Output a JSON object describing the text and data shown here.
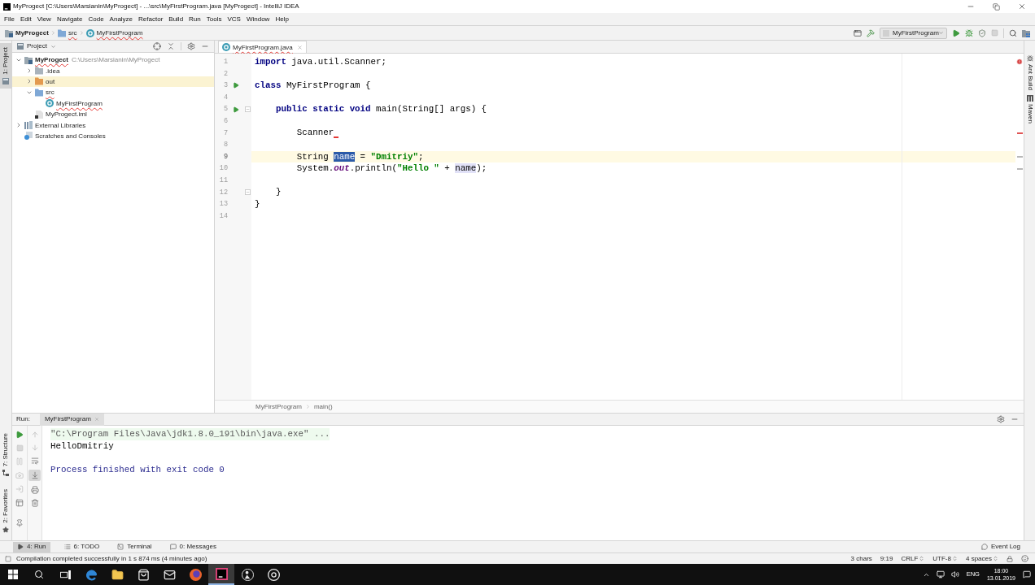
{
  "window": {
    "title": "MyProgect [C:\\Users\\Marsianin\\MyProgect] - ...\\src\\MyFirstProgram.java [MyProgect] - IntelliJ IDEA"
  },
  "menu": [
    "File",
    "Edit",
    "View",
    "Navigate",
    "Code",
    "Analyze",
    "Refactor",
    "Build",
    "Run",
    "Tools",
    "VCS",
    "Window",
    "Help"
  ],
  "navbar": {
    "breadcrumbs": [
      {
        "label": "MyProgect",
        "kind": "project",
        "error": false
      },
      {
        "label": "src",
        "kind": "source_folder",
        "error": true
      },
      {
        "label": "MyFirstProgram",
        "kind": "class",
        "error": true
      }
    ],
    "run_config": "MyFirstProgram"
  },
  "left_stripe": {
    "top": [
      {
        "label": "1: Project",
        "kind": "project",
        "selected": true
      }
    ],
    "bottom": [
      {
        "label": "7: Structure",
        "kind": "structure",
        "selected": false
      },
      {
        "label": "2: Favorites",
        "kind": "favorites",
        "selected": false
      }
    ]
  },
  "project_panel": {
    "title": "Project",
    "tree": [
      {
        "label": "MyProgect",
        "path": "C:\\Users\\Marsianin\\MyProgect",
        "kind": "project",
        "error": true,
        "selected": false,
        "expanded": true,
        "children": [
          {
            "label": ".idea",
            "kind": "folder",
            "error": false,
            "selected": false,
            "expanded": false
          },
          {
            "label": "out",
            "kind": "excluded_folder",
            "error": false,
            "selected": true,
            "expanded": false
          },
          {
            "label": "src",
            "kind": "source_folder",
            "error": true,
            "selected": false,
            "expanded": true,
            "children": [
              {
                "label": "MyFirstProgram",
                "kind": "class",
                "error": true,
                "selected": false
              }
            ]
          },
          {
            "label": "MyProgect.iml",
            "kind": "module_file",
            "error": false,
            "selected": false
          }
        ]
      },
      {
        "label": "External Libraries",
        "kind": "library",
        "error": false,
        "selected": false,
        "expanded": false
      },
      {
        "label": "Scratches and Consoles",
        "kind": "scratches",
        "error": false,
        "selected": false
      }
    ]
  },
  "editor": {
    "tabs": [
      {
        "label": "MyFirstProgram.java",
        "selected": true,
        "error": true
      }
    ],
    "lines": [
      {
        "number": "1",
        "current": false,
        "run": false,
        "fold": false,
        "error": false,
        "tokens": [
          {
            "text": "import",
            "kind": "keyword"
          },
          {
            "text": " java.util.Scanner;",
            "kind": "plain"
          }
        ]
      },
      {
        "number": "2",
        "current": false,
        "run": false,
        "fold": false,
        "error": false
      },
      {
        "number": "3",
        "current": false,
        "run": true,
        "fold": false,
        "error": false,
        "tokens": [
          {
            "text": "class",
            "kind": "keyword"
          },
          {
            "text": " MyFirstProgram {",
            "kind": "plain"
          }
        ]
      },
      {
        "number": "4",
        "current": false,
        "run": false,
        "fold": false,
        "error": false
      },
      {
        "number": "5",
        "current": false,
        "run": true,
        "fold": true,
        "error": false,
        "tokens": [
          {
            "text": "    public static void",
            "kind": "keyword"
          },
          {
            "text": " main(String[] args) {",
            "kind": "plain"
          }
        ]
      },
      {
        "number": "6",
        "current": false,
        "run": false,
        "fold": false,
        "error": false
      },
      {
        "number": "7",
        "current": false,
        "run": false,
        "fold": false,
        "error": true,
        "tokens": [
          {
            "text": "        Scanner",
            "kind": "plain"
          }
        ]
      },
      {
        "number": "8",
        "current": false,
        "run": false,
        "fold": false,
        "error": false
      },
      {
        "number": "9",
        "current": true,
        "run": false,
        "fold": false,
        "error": false,
        "tokens": [
          {
            "text": "        String ",
            "kind": "plain"
          },
          {
            "text": "name",
            "kind": "selection"
          },
          {
            "text": " = ",
            "kind": "plain"
          },
          {
            "text": "\"Dmitriy\"",
            "kind": "string"
          },
          {
            "text": ";",
            "kind": "plain"
          }
        ]
      },
      {
        "number": "10",
        "current": false,
        "run": false,
        "fold": false,
        "error": false,
        "tokens": [
          {
            "text": "        System.",
            "kind": "plain"
          },
          {
            "text": "out",
            "kind": "field"
          },
          {
            "text": ".println(",
            "kind": "plain"
          },
          {
            "text": "\"Hello \"",
            "kind": "string"
          },
          {
            "text": " + ",
            "kind": "plain"
          },
          {
            "text": "name",
            "kind": "usage"
          },
          {
            "text": ");",
            "kind": "plain"
          }
        ]
      },
      {
        "number": "11",
        "current": false,
        "run": false,
        "fold": false,
        "error": false
      },
      {
        "number": "12",
        "current": false,
        "run": false,
        "fold": true,
        "error": false,
        "tokens": [
          {
            "text": "    }",
            "kind": "plain"
          }
        ]
      },
      {
        "number": "13",
        "current": false,
        "run": false,
        "fold": false,
        "error": false,
        "tokens": [
          {
            "text": "}",
            "kind": "plain"
          }
        ]
      },
      {
        "number": "14",
        "current": false,
        "run": false,
        "fold": false,
        "error": false
      }
    ],
    "breadcrumbs": [
      "MyFirstProgram",
      "main()"
    ]
  },
  "right_stripe": [
    {
      "label": "Ant Build",
      "kind": "ant"
    },
    {
      "label": "Maven",
      "kind": "maven"
    }
  ],
  "run_panel": {
    "label": "Run:",
    "tabs": [
      {
        "label": "MyFirstProgram",
        "selected": true
      }
    ],
    "soft_wrap": false,
    "scroll_to_end": true,
    "console": [
      {
        "text": "\"C:\\Program Files\\Java\\jdk1.8.0_191\\bin\\java.exe\" ...",
        "kind": "command"
      },
      {
        "text": "HelloDmitriy",
        "kind": "output"
      },
      {
        "text": "Process finished with exit code 0",
        "kind": "system"
      }
    ]
  },
  "tool_windows": [
    {
      "label": "4: Run",
      "kind": "run",
      "selected": true
    },
    {
      "label": "6: TODO",
      "kind": "todo",
      "selected": false
    },
    {
      "label": "Terminal",
      "kind": "terminal",
      "selected": false
    },
    {
      "label": "0: Messages",
      "kind": "messages",
      "selected": false
    }
  ],
  "event_log": "Event Log",
  "status_bar": {
    "message": "Compilation completed successfully in 1 s 874 ms (4 minutes ago)",
    "items": [
      {
        "label": "3 chars",
        "kind": "text"
      },
      {
        "label": "9:19",
        "kind": "text"
      },
      {
        "label": "CRLF",
        "kind": "menu"
      },
      {
        "label": "UTF-8",
        "kind": "menu"
      },
      {
        "label": "4 spaces",
        "kind": "menu"
      }
    ]
  },
  "taskbar": {
    "apps": [
      {
        "kind": "web_browser",
        "selected": false
      },
      {
        "kind": "folder",
        "selected": false
      },
      {
        "kind": "store",
        "selected": false
      },
      {
        "kind": "mail",
        "selected": false
      },
      {
        "kind": "fox_browser",
        "selected": false
      },
      {
        "kind": "ide",
        "selected": true
      },
      {
        "kind": "media",
        "selected": false
      },
      {
        "kind": "round_browser",
        "selected": false
      }
    ],
    "language": "ENG",
    "time": "18:00",
    "date": "13.01.2019"
  }
}
